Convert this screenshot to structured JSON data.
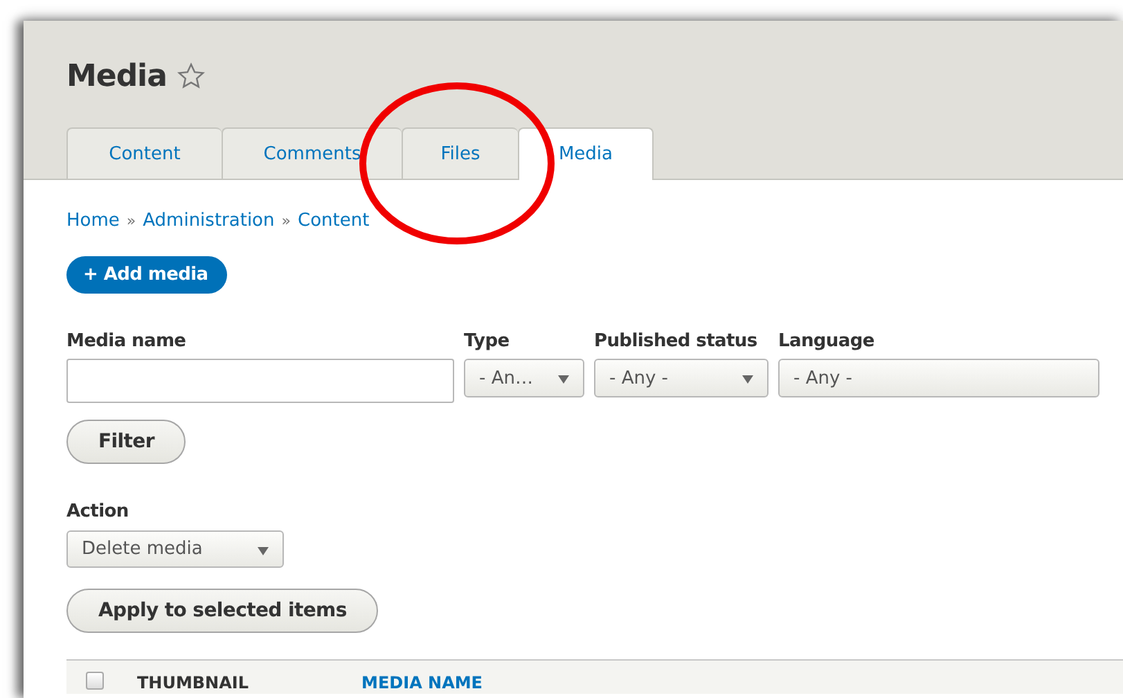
{
  "page": {
    "title": "Media",
    "favorite": false
  },
  "tabs": [
    {
      "label": "Content",
      "selected": false
    },
    {
      "label": "Comments",
      "selected": false
    },
    {
      "label": "Files",
      "selected": false
    },
    {
      "label": "Media",
      "selected": true
    }
  ],
  "annotation": {
    "kind": "ellipse"
  },
  "breadcrumb": {
    "separator": "»",
    "items": [
      "Home",
      "Administration",
      "Content"
    ]
  },
  "primary_action": {
    "label": "+ Add media"
  },
  "filters": [
    {
      "kind": "text",
      "label": "Media name"
    },
    {
      "kind": "select",
      "label": "Type",
      "value": "- An…"
    },
    {
      "kind": "select",
      "label": "Published status",
      "value": "- Any -"
    },
    {
      "kind": "select",
      "label": "Language",
      "value": "- Any -"
    }
  ],
  "filter_button": {
    "label": "Filter"
  },
  "action": {
    "label": "Action",
    "value": "Delete media"
  },
  "apply_button": {
    "label": "Apply to selected items"
  },
  "table": {
    "select_all_checked": false,
    "columns": [
      {
        "label": "THUMBNAIL",
        "sortable": false
      },
      {
        "label": "MEDIA NAME",
        "sortable": true
      }
    ]
  }
}
